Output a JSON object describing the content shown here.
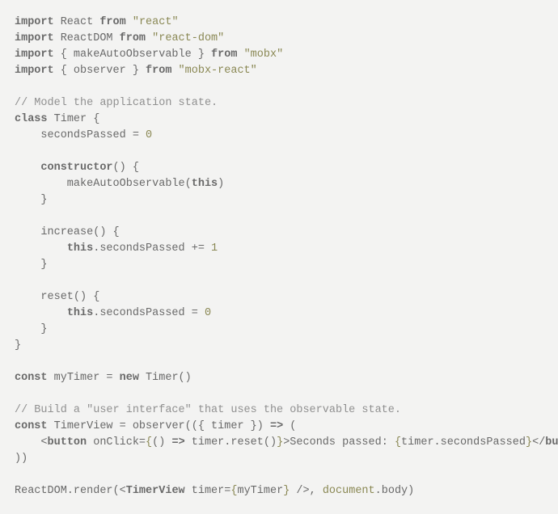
{
  "code": {
    "lines": [
      [
        {
          "t": "import",
          "c": "kw"
        },
        {
          "t": " React "
        },
        {
          "t": "from",
          "c": "kw"
        },
        {
          "t": " "
        },
        {
          "t": "\"react\"",
          "c": "str"
        }
      ],
      [
        {
          "t": "import",
          "c": "kw"
        },
        {
          "t": " ReactDOM "
        },
        {
          "t": "from",
          "c": "kw"
        },
        {
          "t": " "
        },
        {
          "t": "\"react-dom\"",
          "c": "str"
        }
      ],
      [
        {
          "t": "import",
          "c": "kw"
        },
        {
          "t": " { makeAutoObservable } "
        },
        {
          "t": "from",
          "c": "kw"
        },
        {
          "t": " "
        },
        {
          "t": "\"mobx\"",
          "c": "str"
        }
      ],
      [
        {
          "t": "import",
          "c": "kw"
        },
        {
          "t": " { observer } "
        },
        {
          "t": "from",
          "c": "kw"
        },
        {
          "t": " "
        },
        {
          "t": "\"mobx-react\"",
          "c": "str"
        }
      ],
      [],
      [
        {
          "t": "// Model the application state.",
          "c": "cmt"
        }
      ],
      [
        {
          "t": "class",
          "c": "kw"
        },
        {
          "t": " Timer {"
        }
      ],
      [
        {
          "t": "    secondsPassed = "
        },
        {
          "t": "0",
          "c": "num"
        }
      ],
      [],
      [
        {
          "t": "    "
        },
        {
          "t": "constructor",
          "c": "kw"
        },
        {
          "t": "() {"
        }
      ],
      [
        {
          "t": "        makeAutoObservable("
        },
        {
          "t": "this",
          "c": "kw"
        },
        {
          "t": ")"
        }
      ],
      [
        {
          "t": "    }"
        }
      ],
      [],
      [
        {
          "t": "    increase() {"
        }
      ],
      [
        {
          "t": "        "
        },
        {
          "t": "this",
          "c": "kw"
        },
        {
          "t": ".secondsPassed += "
        },
        {
          "t": "1",
          "c": "num"
        }
      ],
      [
        {
          "t": "    }"
        }
      ],
      [],
      [
        {
          "t": "    reset() {"
        }
      ],
      [
        {
          "t": "        "
        },
        {
          "t": "this",
          "c": "kw"
        },
        {
          "t": ".secondsPassed = "
        },
        {
          "t": "0",
          "c": "num"
        }
      ],
      [
        {
          "t": "    }"
        }
      ],
      [
        {
          "t": "}"
        }
      ],
      [],
      [
        {
          "t": "const",
          "c": "kw"
        },
        {
          "t": " myTimer = "
        },
        {
          "t": "new",
          "c": "kw"
        },
        {
          "t": " Timer()"
        }
      ],
      [],
      [
        {
          "t": "// Build a \"user interface\" that uses the observable state.",
          "c": "cmt"
        }
      ],
      [
        {
          "t": "const",
          "c": "kw"
        },
        {
          "t": " TimerView = observer(({ timer }) "
        },
        {
          "t": "=>",
          "c": "kw"
        },
        {
          "t": " ("
        }
      ],
      [
        {
          "t": "    <"
        },
        {
          "t": "button",
          "c": "kw"
        },
        {
          "t": " onClick="
        },
        {
          "t": "{",
          "c": "jsx"
        },
        {
          "t": "() "
        },
        {
          "t": "=>",
          "c": "kw"
        },
        {
          "t": " timer.reset()"
        },
        {
          "t": "}",
          "c": "jsx"
        },
        {
          "t": ">Seconds passed: "
        },
        {
          "t": "{",
          "c": "jsx"
        },
        {
          "t": "timer.secondsPassed"
        },
        {
          "t": "}",
          "c": "jsx"
        },
        {
          "t": "</"
        },
        {
          "t": "button",
          "c": "kw"
        },
        {
          "t": ">"
        }
      ],
      [
        {
          "t": "))"
        }
      ],
      [],
      [
        {
          "t": "ReactDOM.render(<"
        },
        {
          "t": "TimerView",
          "c": "kw"
        },
        {
          "t": " timer="
        },
        {
          "t": "{",
          "c": "jsx"
        },
        {
          "t": "myTimer"
        },
        {
          "t": "}",
          "c": "jsx"
        },
        {
          "t": " />, "
        },
        {
          "t": "document",
          "c": "jsx"
        },
        {
          "t": ".body)"
        }
      ]
    ]
  }
}
